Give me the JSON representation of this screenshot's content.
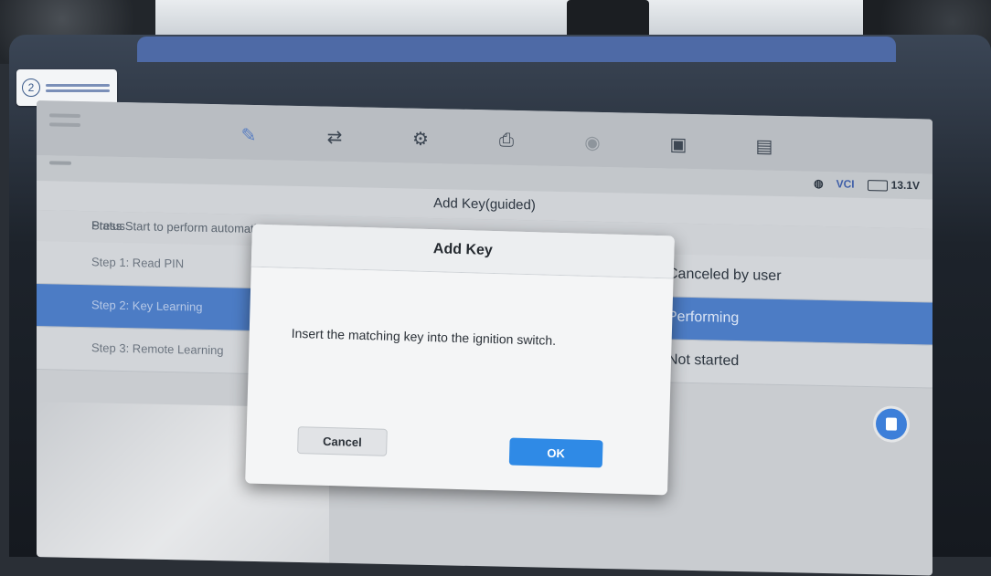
{
  "toolbar": {
    "icons": [
      "edit-icon",
      "shuffle-icon",
      "gear-icon",
      "print-icon",
      "camera-icon",
      "save-icon",
      "message-icon"
    ]
  },
  "status": {
    "vci": "VCI",
    "voltage": "13.1V"
  },
  "page": {
    "title": "Add Key(guided)",
    "intro": "Press Start to perform automatically",
    "status_header": "Status"
  },
  "steps": [
    {
      "name": "Step 1: Read PIN",
      "status": "Canceled by user",
      "selected": false
    },
    {
      "name": "Step 2: Key Learning",
      "status": "Performing",
      "selected": true
    },
    {
      "name": "Step 3: Remote Learning",
      "status": "Not started",
      "selected": false
    }
  ],
  "dialog": {
    "title": "Add Key",
    "message": "Insert the matching key into the ignition switch.",
    "cancel_label": "Cancel",
    "ok_label": "OK"
  },
  "colors": {
    "accent": "#4c7cc5",
    "ok_button": "#2f8ae6"
  }
}
